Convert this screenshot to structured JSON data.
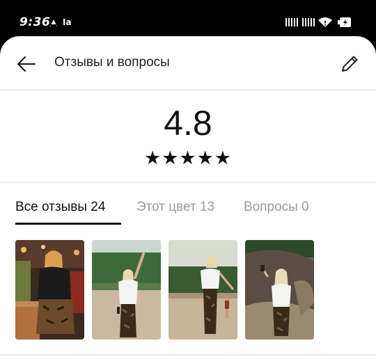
{
  "status_bar": {
    "time": "9:36",
    "carrier_small": "Ia",
    "icons": [
      "alarm-icon",
      "signal-bars-icon",
      "signal-bars-icon",
      "wifi-icon",
      "battery-icon"
    ]
  },
  "header": {
    "title": "Отзывы и вопросы",
    "back_icon": "arrow-left-icon",
    "edit_icon": "pencil-icon"
  },
  "rating": {
    "value": "4.8",
    "stars": "★★★★★",
    "star_count": 5
  },
  "tabs": [
    {
      "label": "Все отзывы 24",
      "active": true
    },
    {
      "label": "Этот цвет 13",
      "active": false
    },
    {
      "label": "Вопросы 0",
      "active": false
    }
  ],
  "photos": [
    {
      "name": "review-photo-1",
      "scene": "indoor"
    },
    {
      "name": "review-photo-2",
      "scene": "beach"
    },
    {
      "name": "review-photo-3",
      "scene": "beach"
    },
    {
      "name": "review-photo-4",
      "scene": "rocks"
    }
  ],
  "colors": {
    "text_primary": "#111111",
    "text_inactive": "#9a9a9a",
    "divider": "#ececec",
    "status_bar_bg": "#000000"
  }
}
